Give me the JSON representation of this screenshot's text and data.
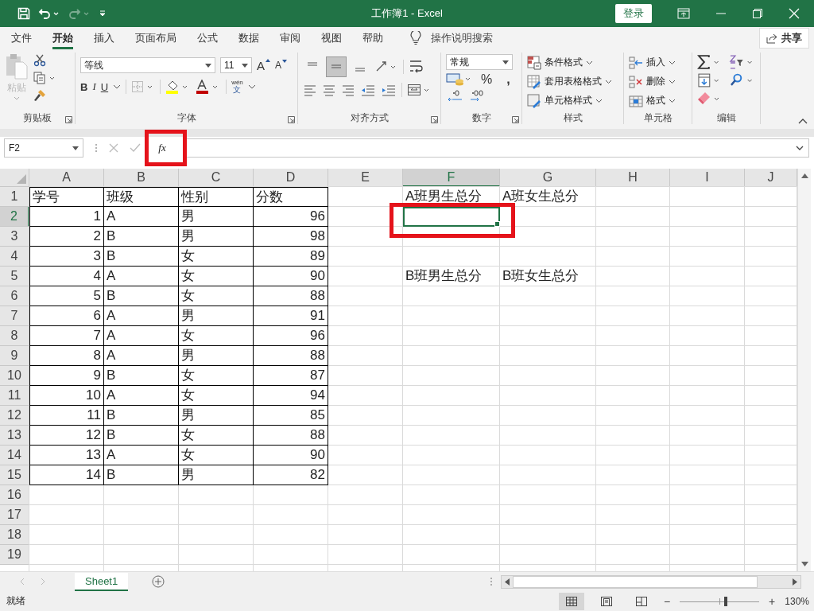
{
  "title_bar": {
    "title": "工作簿1  -  Excel",
    "sign_in": "登录",
    "quick_access": [
      {
        "kind": "save",
        "disabled": false
      },
      {
        "kind": "undo",
        "disabled": false
      },
      {
        "kind": "redo",
        "disabled": true
      },
      {
        "kind": "customize",
        "disabled": false
      }
    ]
  },
  "menu_tabs": [
    {
      "label": "文件",
      "selected": false
    },
    {
      "label": "开始",
      "selected": true
    },
    {
      "label": "插入",
      "selected": false
    },
    {
      "label": "页面布局",
      "selected": false
    },
    {
      "label": "公式",
      "selected": false
    },
    {
      "label": "数据",
      "selected": false
    },
    {
      "label": "审阅",
      "selected": false
    },
    {
      "label": "视图",
      "selected": false
    },
    {
      "label": "帮助",
      "selected": false
    }
  ],
  "tell_me": "操作说明搜索",
  "share": "共享",
  "ribbon": {
    "clipboard": {
      "paste": "粘贴",
      "paste_disabled": true,
      "label": "剪贴板"
    },
    "font": {
      "name": "等线",
      "size": "11",
      "grow": "A",
      "shrink": "A",
      "bold": "B",
      "italic": "I",
      "underline": "U",
      "phonetic_top": "wén",
      "phonetic_bottom": "文",
      "label": "字体"
    },
    "alignment": {
      "vertical": [
        {
          "kind": "top",
          "selected": false
        },
        {
          "kind": "middle",
          "selected": true
        },
        {
          "kind": "bottom",
          "selected": false
        }
      ],
      "label": "对齐方式"
    },
    "number": {
      "format": "常规",
      "percent": "%",
      "comma": ",",
      "label": "数字"
    },
    "styles": {
      "items": [
        {
          "kind": "conditional",
          "label": "条件格式"
        },
        {
          "kind": "table",
          "label": "套用表格格式"
        },
        {
          "kind": "cell",
          "label": "单元格样式"
        }
      ],
      "label": "样式"
    },
    "cells": {
      "items": [
        {
          "kind": "insert",
          "label": "插入"
        },
        {
          "kind": "delete",
          "label": "删除"
        },
        {
          "kind": "format",
          "label": "格式"
        }
      ],
      "label": "单元格"
    },
    "editing": {
      "label": "编辑"
    }
  },
  "formula_bar": {
    "name_box": "F2",
    "fx": "fx",
    "fx_annotated": true
  },
  "columns": [
    {
      "label": "A",
      "selected": false
    },
    {
      "label": "B",
      "selected": false
    },
    {
      "label": "C",
      "selected": false
    },
    {
      "label": "D",
      "selected": false
    },
    {
      "label": "E",
      "selected": false
    },
    {
      "label": "F",
      "selected": true
    },
    {
      "label": "G",
      "selected": false
    },
    {
      "label": "H",
      "selected": false
    },
    {
      "label": "I",
      "selected": false
    },
    {
      "label": "J",
      "selected": false
    }
  ],
  "row_headers": [
    {
      "label": "1",
      "selected": false
    },
    {
      "label": "2",
      "selected": true
    },
    {
      "label": "3",
      "selected": false
    },
    {
      "label": "4",
      "selected": false
    },
    {
      "label": "5",
      "selected": false
    },
    {
      "label": "6",
      "selected": false
    },
    {
      "label": "7",
      "selected": false
    },
    {
      "label": "8",
      "selected": false
    },
    {
      "label": "9",
      "selected": false
    },
    {
      "label": "10",
      "selected": false
    },
    {
      "label": "11",
      "selected": false
    },
    {
      "label": "12",
      "selected": false
    },
    {
      "label": "13",
      "selected": false
    },
    {
      "label": "14",
      "selected": false
    },
    {
      "label": "15",
      "selected": false
    },
    {
      "label": "16",
      "selected": false
    },
    {
      "label": "17",
      "selected": false
    },
    {
      "label": "18",
      "selected": false
    },
    {
      "label": "19",
      "selected": false
    }
  ],
  "table": {
    "columns": [
      {
        "label": "学号",
        "numeric": true
      },
      {
        "label": "班级",
        "numeric": false
      },
      {
        "label": "性别",
        "numeric": false
      },
      {
        "label": "分数",
        "numeric": true
      }
    ],
    "rows": [
      [
        "1",
        "A",
        "男",
        "96"
      ],
      [
        "2",
        "B",
        "男",
        "98"
      ],
      [
        "3",
        "B",
        "女",
        "89"
      ],
      [
        "4",
        "A",
        "女",
        "90"
      ],
      [
        "5",
        "B",
        "女",
        "88"
      ],
      [
        "6",
        "A",
        "男",
        "91"
      ],
      [
        "7",
        "A",
        "女",
        "96"
      ],
      [
        "8",
        "A",
        "男",
        "88"
      ],
      [
        "9",
        "B",
        "女",
        "87"
      ],
      [
        "10",
        "A",
        "女",
        "94"
      ],
      [
        "11",
        "B",
        "男",
        "85"
      ],
      [
        "12",
        "B",
        "女",
        "88"
      ],
      [
        "13",
        "A",
        "女",
        "90"
      ],
      [
        "14",
        "B",
        "男",
        "82"
      ]
    ]
  },
  "summary_labels": [
    "A班男生总分",
    "A班女生总分",
    "B班男生总分",
    "B班女生总分"
  ],
  "selection_annotated": true,
  "sheet_tabs": [
    {
      "label": "Sheet1",
      "selected": true
    }
  ],
  "status_bar": {
    "status": "就绪",
    "views": [
      {
        "kind": "normal",
        "selected": true
      },
      {
        "kind": "page_layout",
        "selected": false
      },
      {
        "kind": "page_break",
        "selected": false
      }
    ],
    "zoom_out": "−",
    "zoom_in": "+",
    "zoom_slider": {
      "level": 0.58
    },
    "zoom": "130%"
  }
}
